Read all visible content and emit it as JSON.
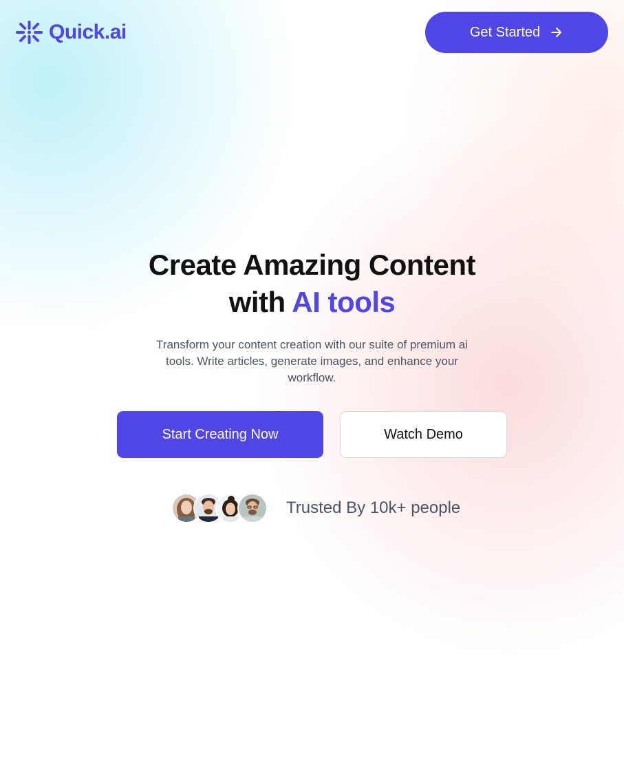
{
  "brand": {
    "name": "Quick.ai",
    "logo_icon": "sparkle-logo-icon",
    "accent_color": "#4F46E5"
  },
  "header": {
    "cta_label": "Get Started",
    "cta_icon": "arrow-right-icon"
  },
  "hero": {
    "title_line1": "Create Amazing Content",
    "title_line2_prefix": "with ",
    "title_line2_accent": "AI tools",
    "subtitle": "Transform your content creation with our suite of premium ai tools. Write articles, generate images, and enhance your workflow.",
    "primary_button": "Start Creating Now",
    "secondary_button": "Watch Demo"
  },
  "trust": {
    "avatars": [
      "avatar-1",
      "avatar-2",
      "avatar-3",
      "avatar-4"
    ],
    "text": "Trusted By 10k+ people"
  }
}
